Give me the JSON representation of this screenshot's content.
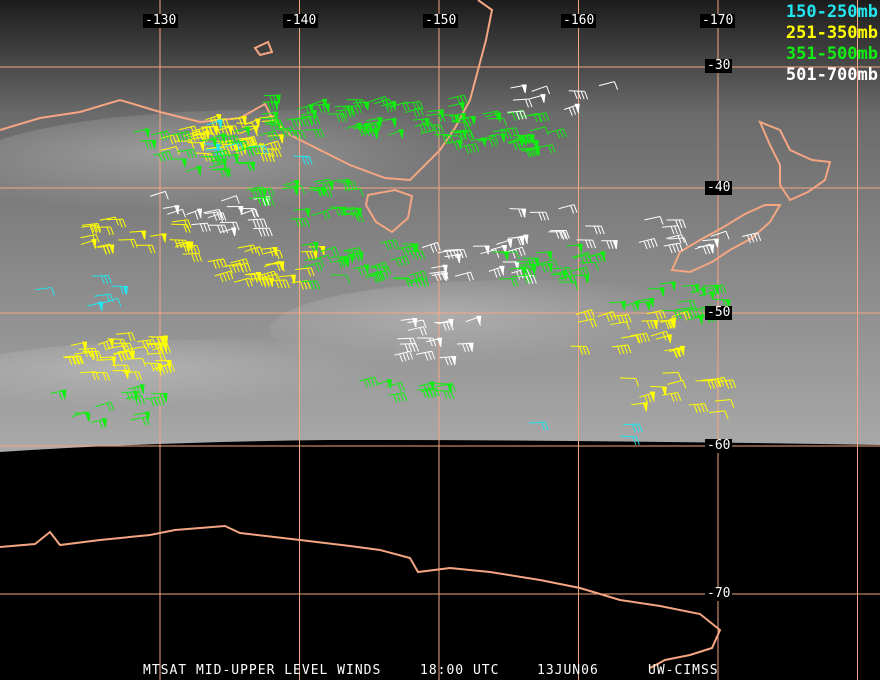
{
  "title": "MTSAT MID-UPPER LEVEL WINDS",
  "time": "18:00 UTC",
  "date": "13JUN06",
  "credit": "UW-CIMSS",
  "longitude_labels": [
    "-130",
    "-140",
    "-150",
    "-160",
    "-170"
  ],
  "latitude_labels": [
    "-30",
    "-40",
    "-50",
    "-60",
    "-70"
  ],
  "legend": [
    {
      "label": "150-250mb",
      "color": "#22e6f0"
    },
    {
      "label": "251-350mb",
      "color": "#ffff00"
    },
    {
      "label": "351-500mb",
      "color": "#11ee11"
    },
    {
      "label": "501-700mb",
      "color": "#ffffff"
    }
  ],
  "colors": {
    "grid": "#f4a582",
    "coast": "#f4a582"
  },
  "wind_clusters": [
    {
      "lon": 134,
      "lat": -35.5,
      "level": 1,
      "n": 40
    },
    {
      "lon": 137,
      "lat": -36,
      "level": 0,
      "n": 6
    },
    {
      "lon": 132,
      "lat": -37,
      "level": 2,
      "n": 25
    },
    {
      "lon": 141,
      "lat": -34,
      "level": 2,
      "n": 30
    },
    {
      "lon": 148,
      "lat": -34,
      "level": 2,
      "n": 25
    },
    {
      "lon": 154,
      "lat": -35.5,
      "level": 2,
      "n": 30
    },
    {
      "lon": 158,
      "lat": -33,
      "level": 3,
      "n": 8
    },
    {
      "lon": 133,
      "lat": -42,
      "level": 3,
      "n": 18
    },
    {
      "lon": 140,
      "lat": -41,
      "level": 2,
      "n": 25
    },
    {
      "lon": 128,
      "lat": -44,
      "level": 1,
      "n": 20
    },
    {
      "lon": 137,
      "lat": -46,
      "level": 1,
      "n": 25
    },
    {
      "lon": 144,
      "lat": -46,
      "level": 2,
      "n": 30
    },
    {
      "lon": 152,
      "lat": -46,
      "level": 3,
      "n": 18
    },
    {
      "lon": 157,
      "lat": -46,
      "level": 2,
      "n": 25
    },
    {
      "lon": 158,
      "lat": -43,
      "level": 3,
      "n": 10
    },
    {
      "lon": 125,
      "lat": -48,
      "level": 0,
      "n": 6
    },
    {
      "lon": 127,
      "lat": -53,
      "level": 1,
      "n": 35
    },
    {
      "lon": 126,
      "lat": -57,
      "level": 2,
      "n": 12
    },
    {
      "lon": 150,
      "lat": -52,
      "level": 3,
      "n": 14
    },
    {
      "lon": 163,
      "lat": -51.5,
      "level": 1,
      "n": 18
    },
    {
      "lon": 166,
      "lat": -49,
      "level": 2,
      "n": 20
    },
    {
      "lon": 168,
      "lat": -44,
      "level": 3,
      "n": 12
    },
    {
      "lon": 166,
      "lat": -56,
      "level": 1,
      "n": 14
    },
    {
      "lon": 160,
      "lat": -58,
      "level": 0,
      "n": 3
    },
    {
      "lon": 147,
      "lat": -55,
      "level": 2,
      "n": 10
    }
  ]
}
